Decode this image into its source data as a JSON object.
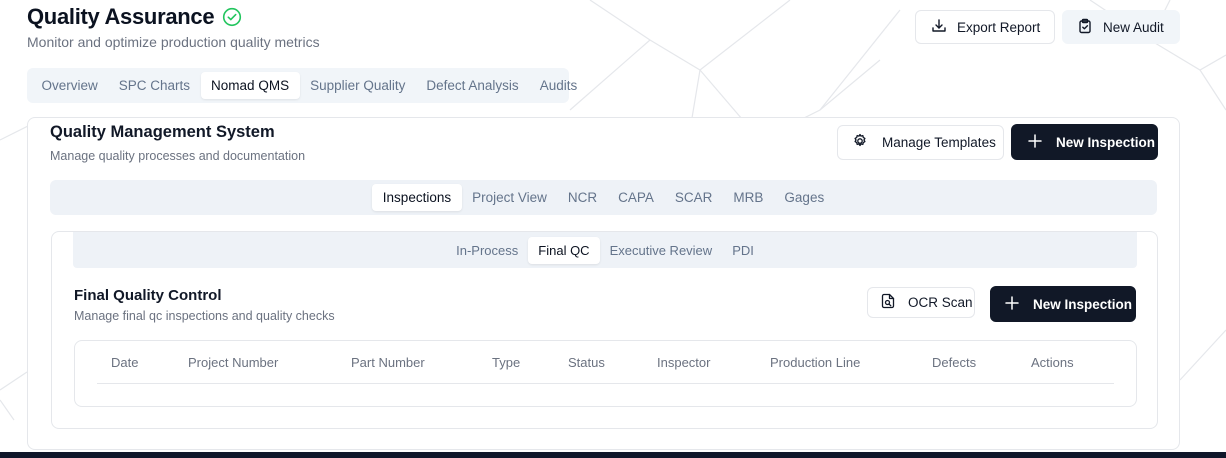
{
  "header": {
    "title": "Quality Assurance",
    "subtitle": "Monitor and optimize production quality metrics",
    "status_icon": "check-circle-icon",
    "export_label": "Export Report",
    "export_icon": "download-icon",
    "new_audit_label": "New Audit",
    "new_audit_icon": "clipboard-check-icon"
  },
  "top_tabs": [
    {
      "label": "Overview",
      "active": false
    },
    {
      "label": "SPC Charts",
      "active": false
    },
    {
      "label": "Nomad QMS",
      "active": true
    },
    {
      "label": "Supplier Quality",
      "active": false
    },
    {
      "label": "Defect Analysis",
      "active": false
    },
    {
      "label": "Audits",
      "active": false
    }
  ],
  "qms": {
    "title": "Quality Management System",
    "subtitle": "Manage quality processes and documentation",
    "manage_templates_label": "Manage Templates",
    "manage_templates_icon": "gear-icon",
    "new_inspection_label": "New Inspection",
    "new_inspection_icon": "plus-icon",
    "tabs": [
      {
        "label": "Inspections",
        "active": true
      },
      {
        "label": "Project View",
        "active": false
      },
      {
        "label": "NCR",
        "active": false
      },
      {
        "label": "CAPA",
        "active": false
      },
      {
        "label": "SCAR",
        "active": false
      },
      {
        "label": "MRB",
        "active": false
      },
      {
        "label": "Gages",
        "active": false
      }
    ]
  },
  "inspections": {
    "sub_tabs": [
      {
        "label": "In-Process",
        "active": false
      },
      {
        "label": "Final QC",
        "active": true
      },
      {
        "label": "Executive Review",
        "active": false
      },
      {
        "label": "PDI",
        "active": false
      }
    ],
    "section_title": "Final Quality Control",
    "section_subtitle": "Manage final qc inspections and quality checks",
    "ocr_label": "OCR Scan",
    "ocr_icon": "file-scan-icon",
    "new_inspection_label": "New Inspection",
    "new_inspection_icon": "plus-icon",
    "columns": [
      "Date",
      "Project Number",
      "Part Number",
      "Type",
      "Status",
      "Inspector",
      "Production Line",
      "Defects",
      "Actions"
    ],
    "rows": []
  },
  "colors": {
    "primary_dark": "#111827",
    "success": "#22c55e",
    "muted_text": "#6b7280",
    "tab_bg": "#f1f5f9"
  }
}
